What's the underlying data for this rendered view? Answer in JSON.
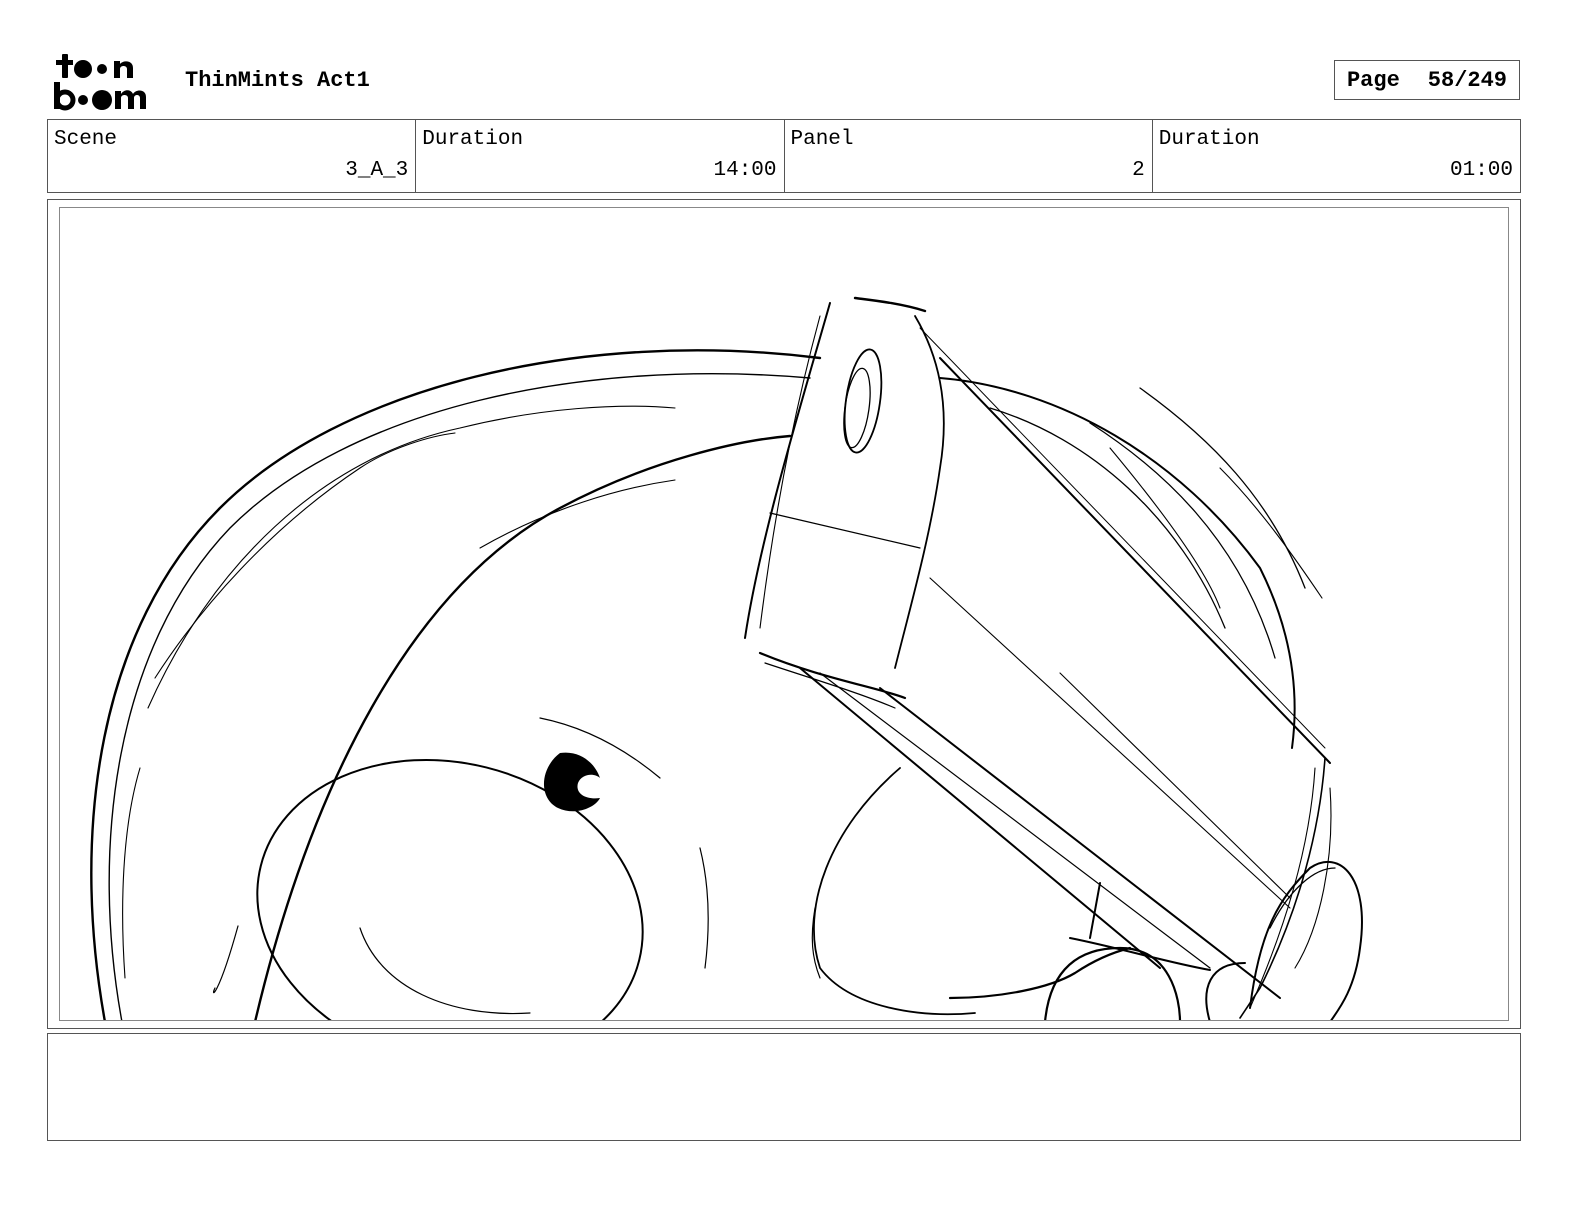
{
  "header": {
    "logo": {
      "line1": "toon",
      "line2": "boom"
    },
    "project_title": "ThinMints Act1",
    "page_label": "Page",
    "page_value": "58/249"
  },
  "info": {
    "scene_label": "Scene",
    "scene_value": "3_A_3",
    "scene_duration_label": "Duration",
    "scene_duration_value": "14:00",
    "panel_label": "Panel",
    "panel_value": "2",
    "panel_duration_label": "Duration",
    "panel_duration_value": "01:00"
  },
  "notes": {
    "text": ""
  }
}
